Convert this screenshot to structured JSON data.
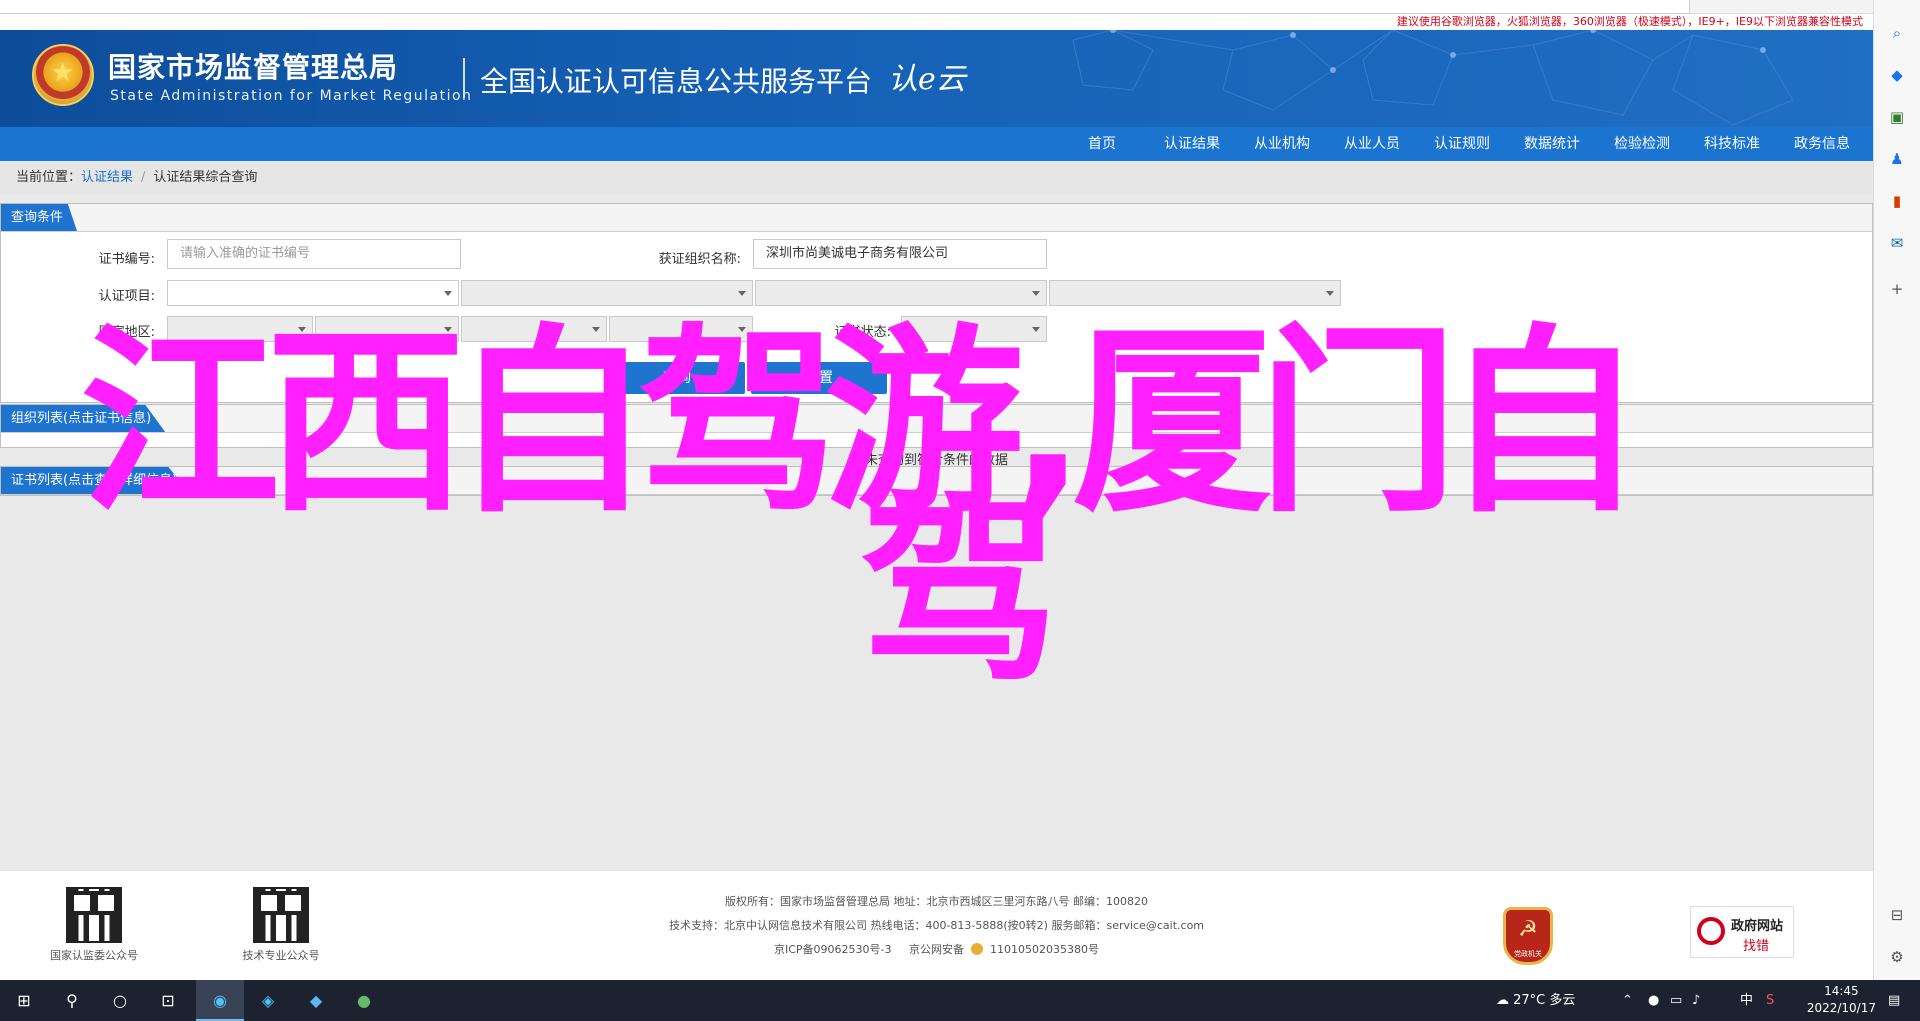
{
  "notice": "建议使用谷歌浏览器，火狐浏览器，360浏览器（极速模式），IE9+，IE9以下浏览器兼容性模式",
  "header": {
    "agency_cn": "国家市场监督管理总局",
    "agency_en": "State Administration  for  Market Regulation",
    "platform": "全国认证认可信息公共服务平台",
    "logo_text": "认e云"
  },
  "nav": [
    "首页",
    "认证结果",
    "从业机构",
    "从业人员",
    "认证规则",
    "数据统计",
    "检验检测",
    "科技标准",
    "政务信息"
  ],
  "breadcrumb": {
    "prefix": "当前位置：",
    "link": "认证结果",
    "sep": "/",
    "current": "认证结果综合查询"
  },
  "query": {
    "tab": "查询条件",
    "cert_no_label": "证书编号:",
    "cert_no_placeholder": "请输入准确的证书编号",
    "org_label": "获证组织名称:",
    "org_value": "深圳市尚美诚电子商务有限公司",
    "item_label": "认证项目:",
    "region_label": "国家地区:",
    "status_label": "证书状态:",
    "search_btn": "查询",
    "reset_btn": "重置"
  },
  "org_list": {
    "tab": "组织列表(点击证书信息)",
    "empty": "未查询到符合条件的数据"
  },
  "cert_list": {
    "tab": "证书列表(点击查看详细信息)"
  },
  "overlay": {
    "line1": "江西自驾游,厦门自",
    "line2": "驾"
  },
  "footer": {
    "qr1_caption": "国家认监委公众号",
    "qr2_caption": "技术专业公众号",
    "line1": "版权所有：国家市场监督管理总局    地址：北京市西城区三里河东路八号    邮编：100820",
    "line2": "技术支持：北京中认网信息技术有限公司    热线电话：400-813-5888(按0转2)    服务邮箱：service@cait.com",
    "icp": "京ICP备09062530号-3",
    "police": "京公网安备",
    "police_no": "11010502035380号",
    "badge_label": "党政机关",
    "error_title": "政府网站",
    "error_action": "找错"
  },
  "taskbar": {
    "weather": "27°C  多云",
    "ime": "中",
    "time": "14:45",
    "date": "2022/10/17"
  }
}
